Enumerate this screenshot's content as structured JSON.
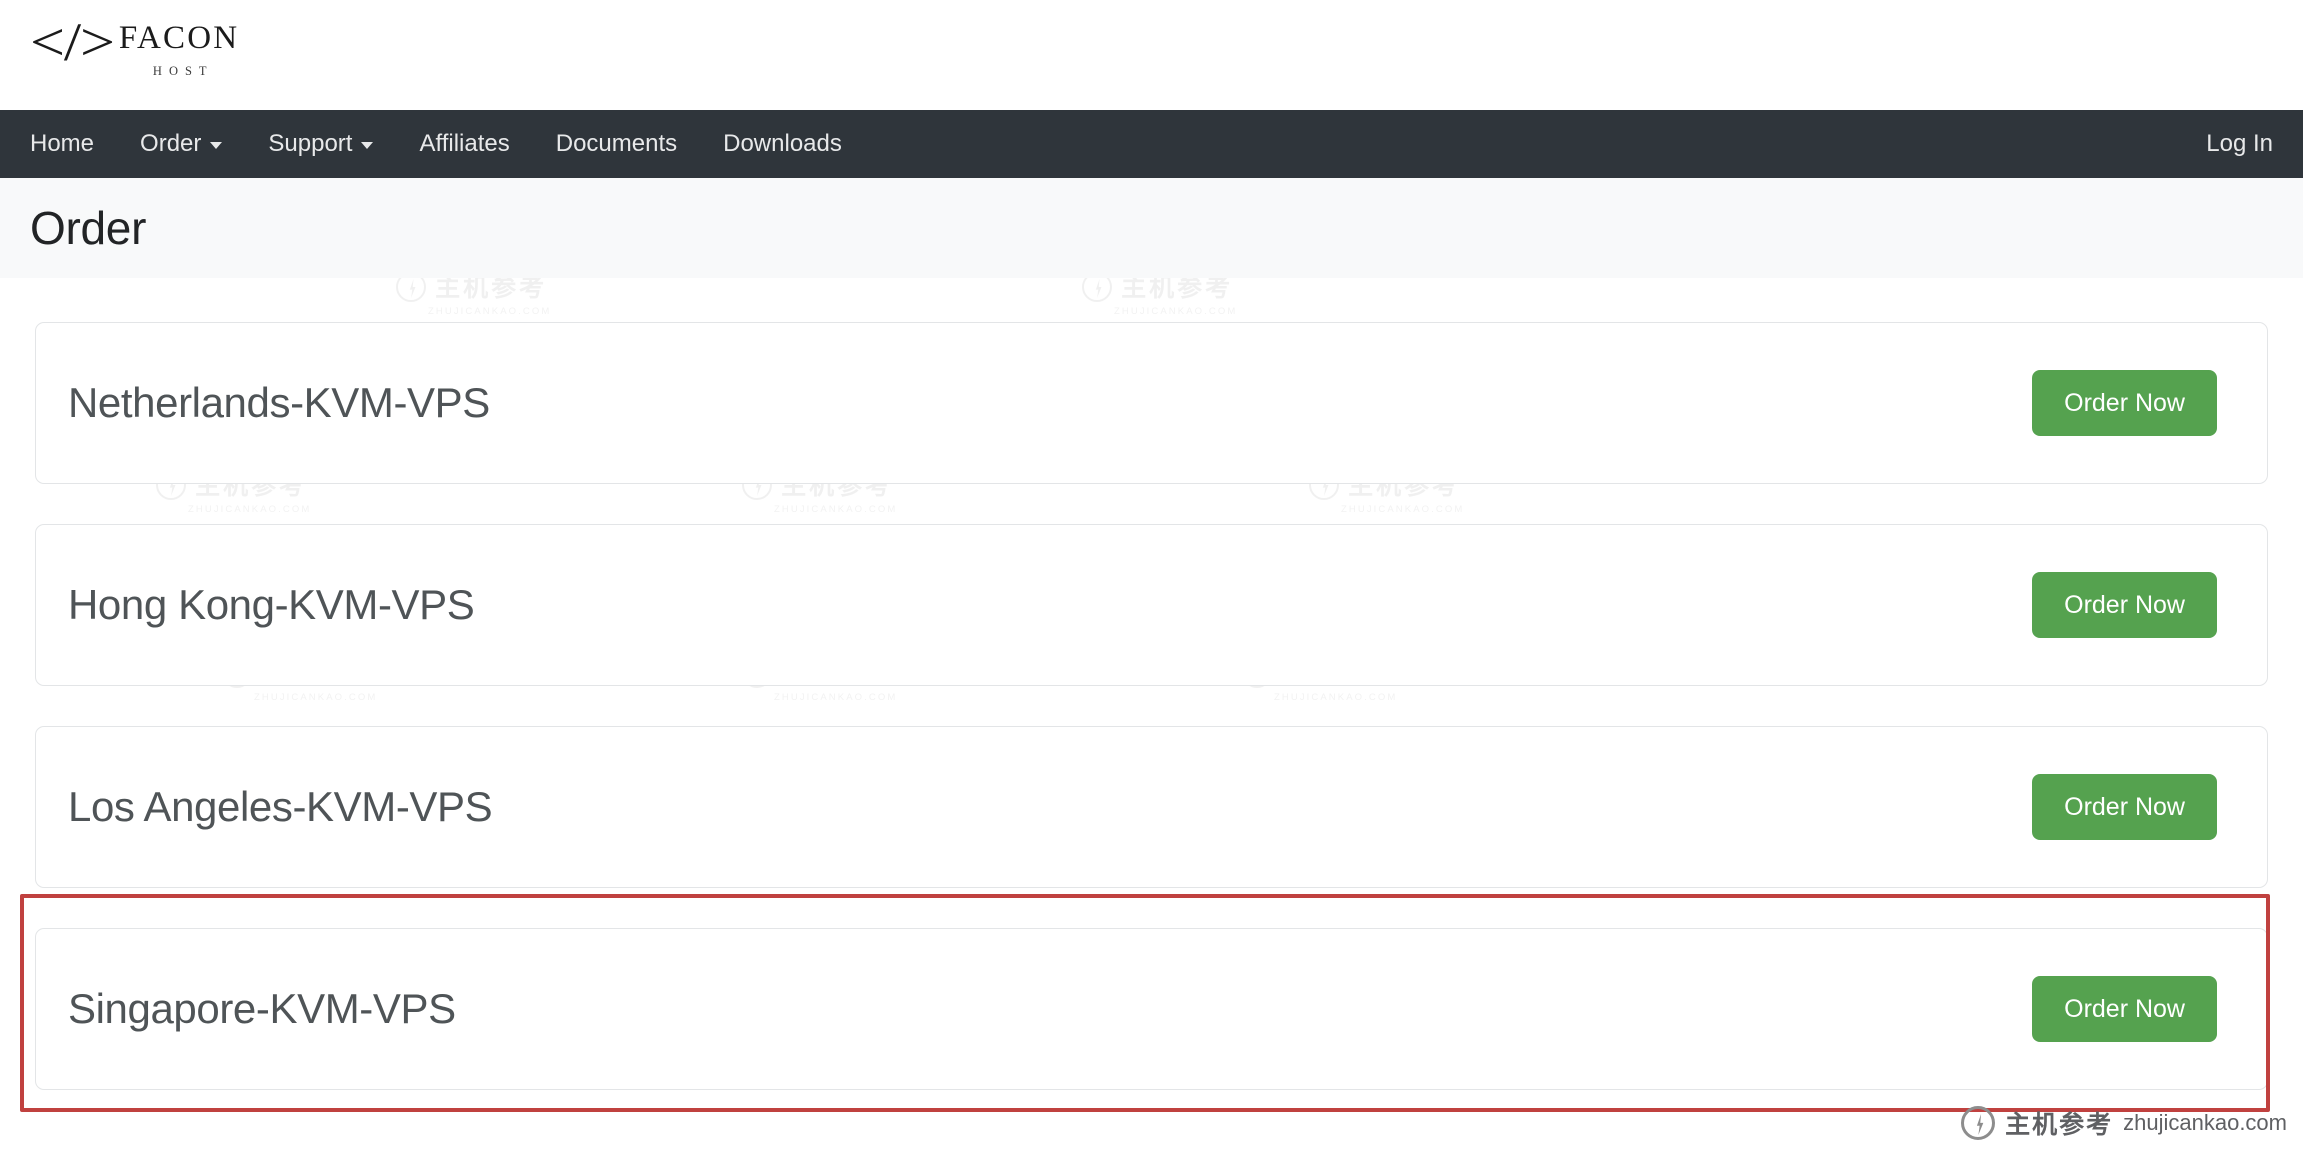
{
  "brand": {
    "code_glyph": "</>",
    "name": "FACON",
    "subtitle": "HOST"
  },
  "navbar": {
    "items": [
      {
        "label": "Home",
        "has_dropdown": false
      },
      {
        "label": "Order",
        "has_dropdown": true
      },
      {
        "label": "Support",
        "has_dropdown": true
      },
      {
        "label": "Affiliates",
        "has_dropdown": false
      },
      {
        "label": "Documents",
        "has_dropdown": false
      },
      {
        "label": "Downloads",
        "has_dropdown": false
      }
    ],
    "login_label": "Log In",
    "background_color": "#2f353b"
  },
  "header": {
    "title": "Order",
    "background_color": "#f8f9fa"
  },
  "products": {
    "order_button_label": "Order Now",
    "accent_color": "#55a24f",
    "items": [
      {
        "name": "Netherlands-KVM-VPS",
        "button_label": "Order Now",
        "highlighted": false
      },
      {
        "name": "Hong Kong-KVM-VPS",
        "button_label": "Order Now",
        "highlighted": false
      },
      {
        "name": "Los Angeles-KVM-VPS",
        "button_label": "Order Now",
        "highlighted": false
      },
      {
        "name": "Singapore-KVM-VPS",
        "button_label": "Order Now",
        "highlighted": true
      }
    ]
  },
  "highlight": {
    "color": "#c0413f",
    "target_product": "Singapore-KVM-VPS"
  },
  "watermark": {
    "cn_text": "主机参考",
    "url_text": "ZHUJICANKAO.COM",
    "color": "#dcdcdc"
  },
  "attribution": {
    "cn_text": "主机参考",
    "url_text": "zhujicankao.com",
    "color": "#5f6063"
  }
}
